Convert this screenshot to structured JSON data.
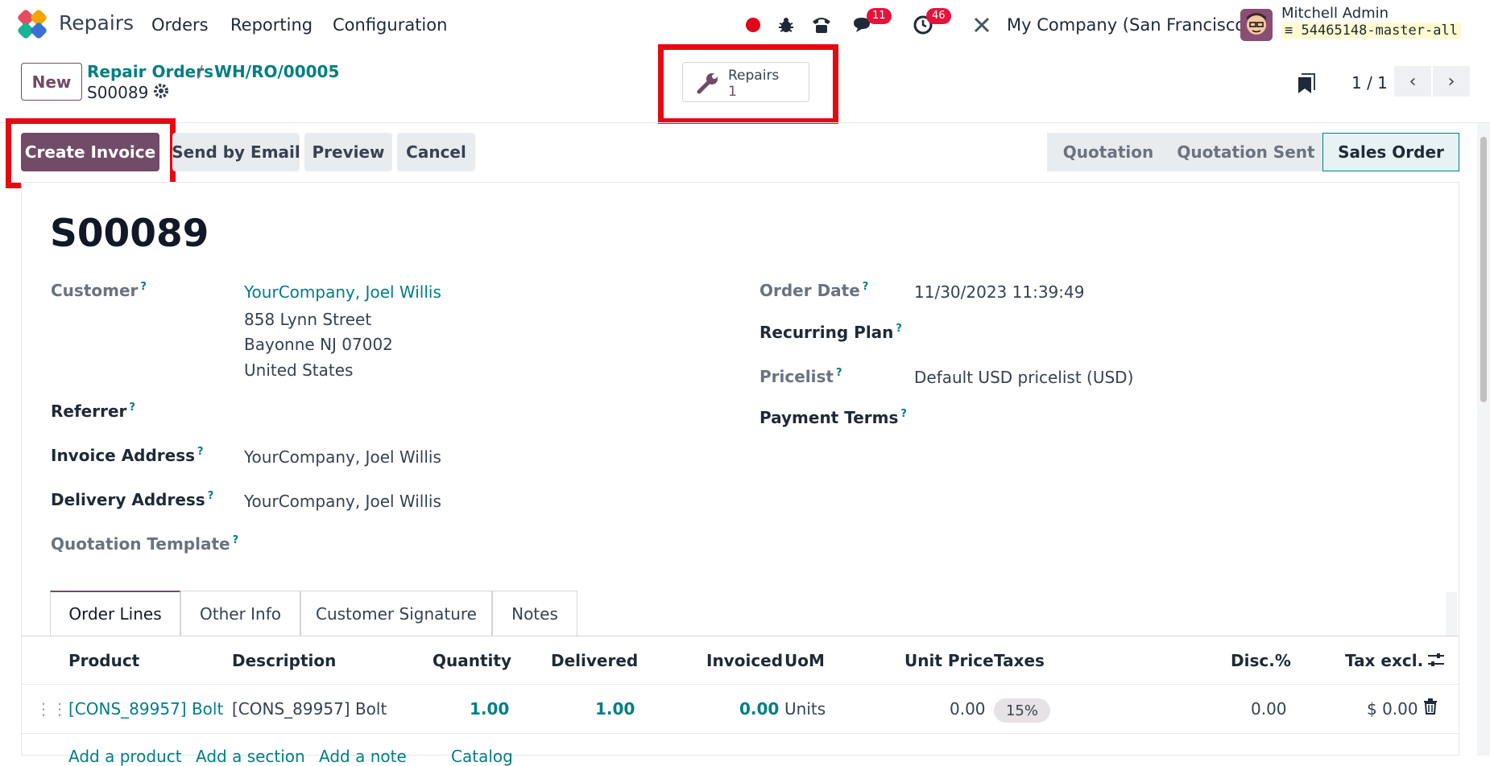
{
  "navbar": {
    "app_name": "Repairs",
    "menu": [
      "Orders",
      "Reporting",
      "Configuration"
    ],
    "chat_badge": "11",
    "activity_badge": "46",
    "company": "My Company (San Francisco)",
    "user_name": "Mitchell Admin",
    "db_name": "54465148-master-all"
  },
  "control_panel": {
    "new_label": "New",
    "breadcrumb": [
      "Repair Orders",
      "WH/RO/00005"
    ],
    "record_name": "S00089",
    "smart_button": {
      "label": "Repairs",
      "count": "1"
    },
    "pager_value": "1 / 1"
  },
  "actions": {
    "create_invoice": "Create Invoice",
    "send_email": "Send by Email",
    "preview": "Preview",
    "cancel": "Cancel"
  },
  "status": [
    "Quotation",
    "Quotation Sent",
    "Sales Order"
  ],
  "form": {
    "title": "S00089",
    "customer_label": "Customer",
    "customer_name": "YourCompany, Joel Willis",
    "customer_address": [
      "858 Lynn Street",
      "Bayonne NJ 07002",
      "United States"
    ],
    "referrer_label": "Referrer",
    "invoice_address_label": "Invoice Address",
    "invoice_address": "YourCompany, Joel Willis",
    "delivery_address_label": "Delivery Address",
    "delivery_address": "YourCompany, Joel Willis",
    "quotation_template_label": "Quotation Template",
    "order_date_label": "Order Date",
    "order_date": "11/30/2023 11:39:49",
    "recurring_plan_label": "Recurring Plan",
    "pricelist_label": "Pricelist",
    "pricelist": "Default USD pricelist (USD)",
    "payment_terms_label": "Payment Terms",
    "help_mark": "?"
  },
  "tabs": [
    "Order Lines",
    "Other Info",
    "Customer Signature",
    "Notes"
  ],
  "table": {
    "headers": [
      "Product",
      "Description",
      "Quantity",
      "Delivered",
      "Invoiced",
      "UoM",
      "Unit Price",
      "Taxes",
      "Disc.%",
      "Tax excl."
    ],
    "rows": [
      {
        "product": "[CONS_89957] Bolt",
        "description": "[CONS_89957] Bolt",
        "quantity": "1.00",
        "delivered": "1.00",
        "invoiced": "0.00",
        "uom": "Units",
        "unit_price": "0.00",
        "taxes": "15%",
        "discount": "0.00",
        "tax_excl": "$ 0.00"
      }
    ],
    "add_links": [
      "Add a product",
      "Add a section",
      "Add a note",
      "Catalog"
    ]
  },
  "colors": {
    "brand": "#714b67",
    "link": "#017e84",
    "highlight": "#e50a12",
    "badge": "#e5133b"
  }
}
